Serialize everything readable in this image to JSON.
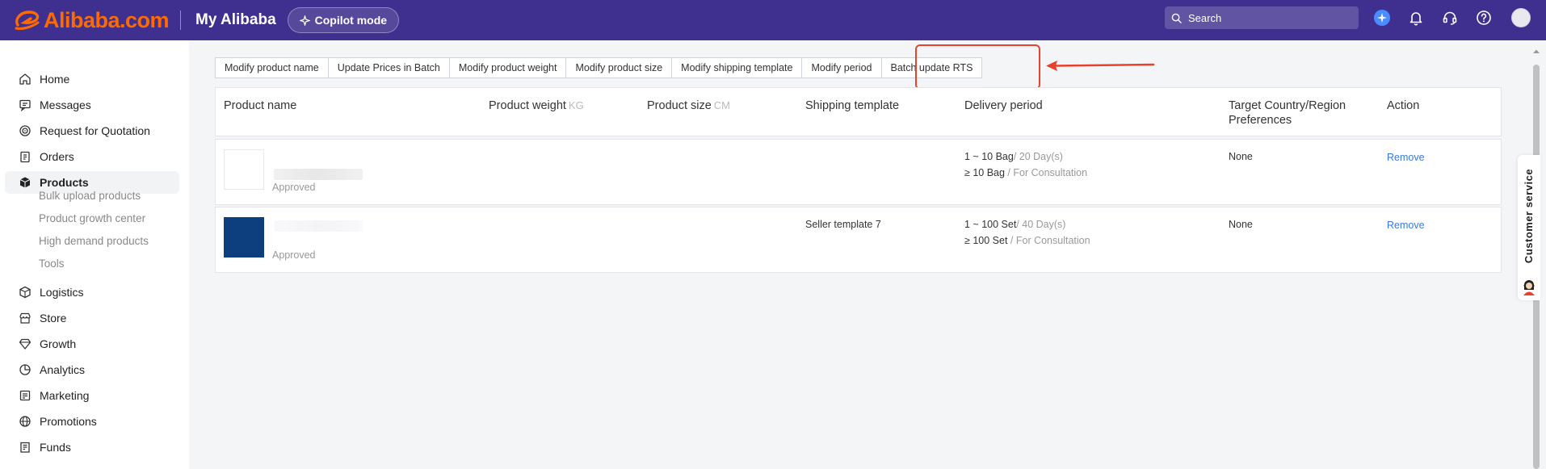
{
  "colors": {
    "topbar": "#3f308f",
    "brand": "#ff6a00",
    "accent": "#e5432d",
    "link": "#3a7ae0"
  },
  "header": {
    "logo_text": "Alibaba.com",
    "app_title": "My Alibaba",
    "copilot_label": "Copilot mode",
    "search_placeholder": "Search",
    "icons": [
      "copilot-spark-icon",
      "bell-icon",
      "headset-icon",
      "help-icon",
      "avatar"
    ]
  },
  "sidebar": {
    "items": [
      {
        "label": "Home",
        "icon": "home-icon"
      },
      {
        "label": "Messages",
        "icon": "message-icon"
      },
      {
        "label": "Request for Quotation",
        "icon": "target-icon"
      },
      {
        "label": "Orders",
        "icon": "clipboard-icon"
      },
      {
        "label": "Products",
        "icon": "box-icon",
        "active": true
      },
      {
        "label": "Logistics",
        "icon": "truck-icon"
      },
      {
        "label": "Store",
        "icon": "store-icon"
      },
      {
        "label": "Growth",
        "icon": "diamond-icon"
      },
      {
        "label": "Analytics",
        "icon": "pie-chart-icon"
      },
      {
        "label": "Marketing",
        "icon": "document-icon"
      },
      {
        "label": "Promotions",
        "icon": "globe-icon"
      },
      {
        "label": "Funds",
        "icon": "ledger-icon"
      }
    ],
    "sub_items": [
      "Bulk upload products",
      "Product growth center",
      "High demand products",
      "Tools"
    ]
  },
  "tabs": [
    "Modify product name",
    "Update Prices in Batch",
    "Modify product weight",
    "Modify product size",
    "Modify shipping template",
    "Modify period",
    "Batch update RTS"
  ],
  "table": {
    "headers": {
      "product_name": "Product name",
      "product_weight": "Product weight",
      "weight_unit": "KG",
      "product_size": "Product size",
      "size_unit": "CM",
      "shipping_template": "Shipping template",
      "delivery_period": "Delivery period",
      "target_country_1": "Target Country/Region",
      "target_country_2": "Preferences",
      "action": "Action"
    },
    "rows": [
      {
        "status": "Approved",
        "shipping_template": "",
        "period_1_qty": "1 ~ 10 Bag",
        "period_1_days": "/ 20 Day(s)",
        "period_2_qty": "≥ 10 Bag",
        "period_2_note": " / For Consultation",
        "target": "None",
        "action": "Remove"
      },
      {
        "status": "Approved",
        "shipping_template": "Seller template 7",
        "period_1_qty": "1 ~ 100 Set",
        "period_1_days": "/ 40 Day(s)",
        "period_2_qty": "≥ 100 Set",
        "period_2_note": " / For Consultation",
        "target": "None",
        "action": "Remove"
      }
    ]
  },
  "customer_service": "Customer service"
}
